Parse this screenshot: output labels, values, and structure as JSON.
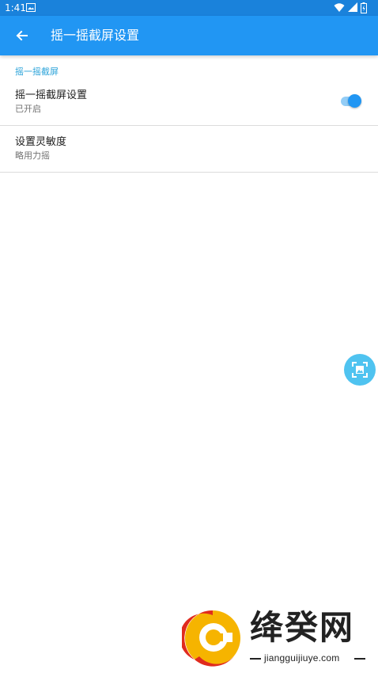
{
  "status_bar": {
    "time": "1:41",
    "icons": [
      "image-icon",
      "wifi-icon",
      "signal-icon",
      "battery-icon"
    ]
  },
  "app_bar": {
    "title": "摇一摇截屏设置",
    "back_icon": "arrow-left-icon",
    "color": "#2196f3"
  },
  "section": {
    "header": "摇一摇截屏"
  },
  "settings": [
    {
      "title": "摇一摇截屏设置",
      "summary": "已开启",
      "toggle_on": true
    },
    {
      "title": "设置灵敏度",
      "summary": "略用力摇"
    }
  ],
  "floating_button": {
    "icon": "screenshot-icon",
    "color": "#4fc3f0"
  },
  "watermark": {
    "brand": "绛癸网",
    "url": "jiangguijiuye.com"
  }
}
